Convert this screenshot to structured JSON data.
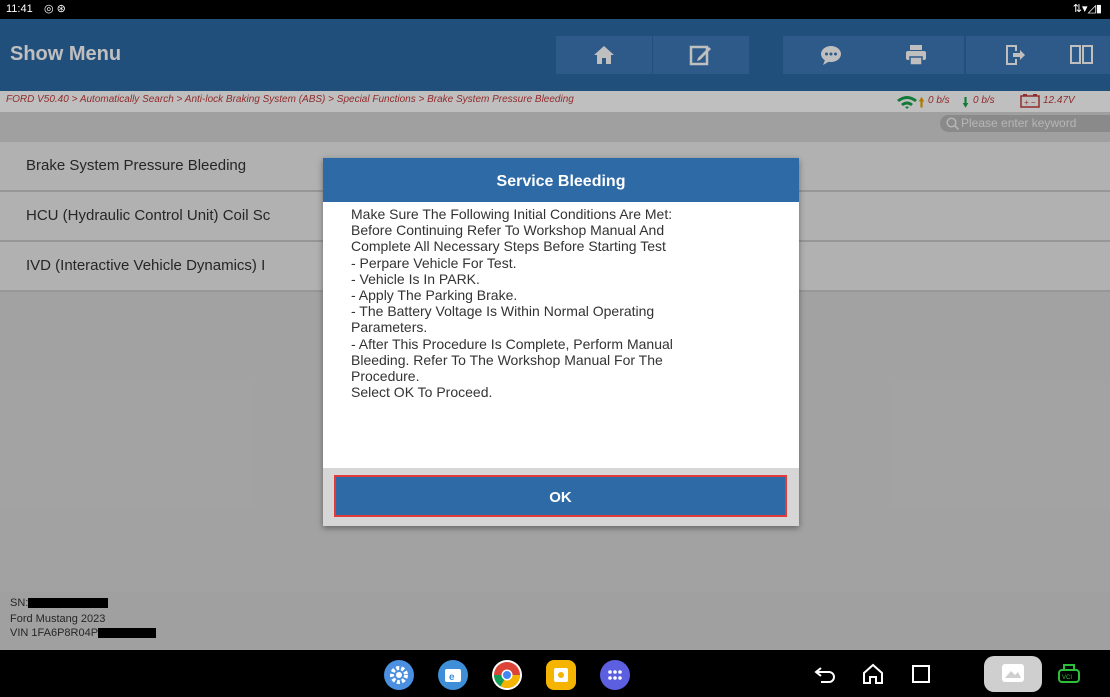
{
  "status_bar": {
    "time": "11:41"
  },
  "header": {
    "title": "Show Menu"
  },
  "toolbar": {
    "buttons": [
      {
        "name": "home-icon"
      },
      {
        "name": "edit-icon"
      },
      {
        "name": "chat-icon"
      },
      {
        "name": "print-icon"
      },
      {
        "name": "exit-icon"
      },
      {
        "name": "layout-icon"
      }
    ]
  },
  "breadcrumb": {
    "text": "FORD V50.40 > Automatically Search > Anti-lock Braking System (ABS) > Special Functions > Brake System Pressure Bleeding"
  },
  "stats": {
    "up": "0 b/s",
    "down": "0 b/s",
    "voltage": "12.47V"
  },
  "search": {
    "placeholder": "Please enter keyword"
  },
  "menu": {
    "items": [
      "Brake System Pressure Bleeding",
      "HCU (Hydraulic Control Unit) Coil Sc",
      "IVD (Interactive Vehicle Dynamics) I"
    ]
  },
  "vehicle": {
    "sn_label": "SN:",
    "model": "Ford Mustang 2023",
    "vin_label": "VIN 1FA6P8R04P"
  },
  "dialog": {
    "title": "Service Bleeding",
    "lines": [
      "Make Sure The Following Initial Conditions Are Met:",
      "Before Continuing Refer To Workshop Manual And",
      "Complete All Necessary Steps Before Starting Test",
      "- Perpare Vehicle For Test.",
      "- Vehicle Is In PARK.",
      "- Apply The Parking Brake.",
      "- The Battery Voltage Is Within Normal Operating",
      "Parameters.",
      "- After This Procedure Is Complete, Perform Manual",
      "Bleeding. Refer To The Workshop Manual For The",
      "Procedure.",
      "Select OK To Proceed."
    ],
    "ok_label": "OK"
  },
  "colors": {
    "header_blue": "#2d6aa6",
    "breadcrumb_red": "#c23b3b",
    "highlight_red": "#e03a3a"
  }
}
